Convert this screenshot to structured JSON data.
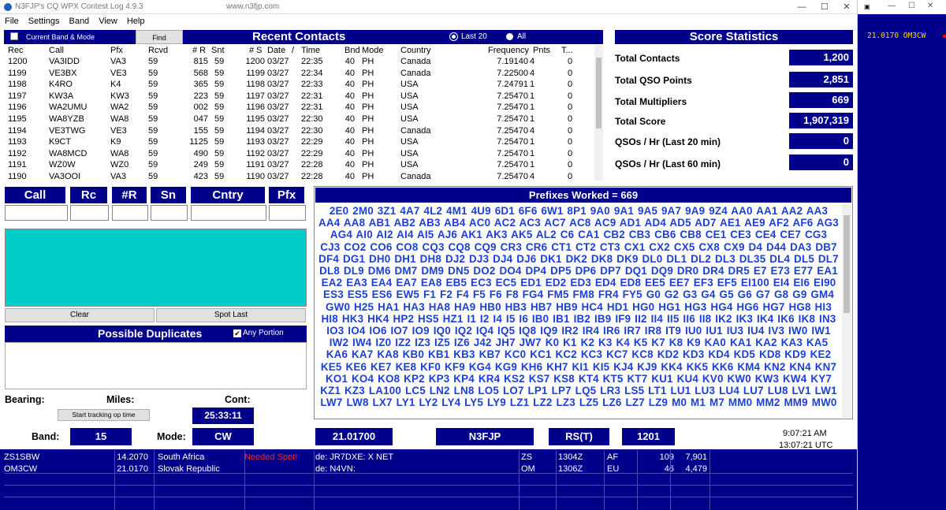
{
  "window": {
    "title": "N3FJP's CQ WPX Contest Log 4.9.3",
    "url": "www.n3fjp.com",
    "minimize": "—",
    "maximize": "☐",
    "close": "✕"
  },
  "menu": [
    "File",
    "Settings",
    "Band",
    "View",
    "Help"
  ],
  "recent": {
    "checkbox_label": "Current Band & Mode",
    "find_label": "Find",
    "title": "Recent Contacts",
    "radio_last20": "Last 20",
    "radio_all": "All",
    "columns": [
      "Rec",
      "Call",
      "Pfx",
      "Rcvd",
      "# R",
      "Snt",
      "# S",
      "Date",
      "/",
      "Time",
      "Bnd",
      "Mode",
      "Country",
      "Frequency",
      "Pnts",
      "T..."
    ],
    "rows": [
      [
        "1200",
        "VA3IDD",
        "VA3",
        "59",
        "815",
        "59",
        "1200",
        "03/27",
        "22:35",
        "40",
        "PH",
        "Canada",
        "7.19140",
        "4",
        "0"
      ],
      [
        "1199",
        "VE3BX",
        "VE3",
        "59",
        "568",
        "59",
        "1199",
        "03/27",
        "22:34",
        "40",
        "PH",
        "Canada",
        "7.22500",
        "4",
        "0"
      ],
      [
        "1198",
        "K4RO",
        "K4",
        "59",
        "365",
        "59",
        "1198",
        "03/27",
        "22:33",
        "40",
        "PH",
        "USA",
        "7.24791",
        "1",
        "0"
      ],
      [
        "1197",
        "KW3A",
        "KW3",
        "59",
        "223",
        "59",
        "1197",
        "03/27",
        "22:31",
        "40",
        "PH",
        "USA",
        "7.25470",
        "1",
        "0"
      ],
      [
        "1196",
        "WA2UMU",
        "WA2",
        "59",
        "002",
        "59",
        "1196",
        "03/27",
        "22:31",
        "40",
        "PH",
        "USA",
        "7.25470",
        "1",
        "0"
      ],
      [
        "1195",
        "WA8YZB",
        "WA8",
        "59",
        "047",
        "59",
        "1195",
        "03/27",
        "22:30",
        "40",
        "PH",
        "USA",
        "7.25470",
        "1",
        "0"
      ],
      [
        "1194",
        "VE3TWG",
        "VE3",
        "59",
        "155",
        "59",
        "1194",
        "03/27",
        "22:30",
        "40",
        "PH",
        "Canada",
        "7.25470",
        "4",
        "0"
      ],
      [
        "1193",
        "K9CT",
        "K9",
        "59",
        "1125",
        "59",
        "1193",
        "03/27",
        "22:29",
        "40",
        "PH",
        "USA",
        "7.25470",
        "1",
        "0"
      ],
      [
        "1192",
        "WA8MCD",
        "WA8",
        "59",
        "490",
        "59",
        "1192",
        "03/27",
        "22:29",
        "40",
        "PH",
        "USA",
        "7.25470",
        "1",
        "0"
      ],
      [
        "1191",
        "WZ0W",
        "WZ0",
        "59",
        "249",
        "59",
        "1191",
        "03/27",
        "22:28",
        "40",
        "PH",
        "USA",
        "7.25470",
        "1",
        "0"
      ],
      [
        "1190",
        "VA3OOI",
        "VA3",
        "59",
        "423",
        "59",
        "1190",
        "03/27",
        "22:28",
        "40",
        "PH",
        "Canada",
        "7.25470",
        "4",
        "0"
      ]
    ]
  },
  "stats": {
    "title": "Score Statistics",
    "items": [
      {
        "label": "Total Contacts",
        "value": "1,200"
      },
      {
        "label": "Total QSO Points",
        "value": "2,851"
      },
      {
        "label": "Total Multipliers",
        "value": "669"
      },
      {
        "label": "Total Score",
        "value": "1,907,319"
      },
      {
        "label": "QSOs / Hr (Last 20 min)",
        "value": "0"
      },
      {
        "label": "QSOs / Hr (Last 60 min)",
        "value": "0"
      }
    ]
  },
  "entry": {
    "call": "Call",
    "rc": "Rc",
    "nr": "#R",
    "sn": "Sn",
    "cntry": "Cntry",
    "pfx": "Pfx"
  },
  "buttons": {
    "clear": "Clear",
    "spot_last": "Spot Last",
    "track": "Start tracking op time"
  },
  "dupes": {
    "title": "Possible Duplicates",
    "any_portion": "Any Portion"
  },
  "info": {
    "bearing": "Bearing:",
    "miles": "Miles:",
    "cont": "Cont:",
    "timer": "25:33:11",
    "band_label": "Band:",
    "band": "15",
    "mode_label": "Mode:",
    "mode": "CW",
    "freq": "21.01700",
    "operator": "N3FJP",
    "rst": "RS(T)",
    "next": "1201",
    "local_time": "9:07:21  AM",
    "utc_time": "13:07:21  UTC"
  },
  "prefixes": {
    "title": "Prefixes Worked = 669",
    "text": "2E0 2M0 3Z1 4A7 4L2 4M1 4U9 6D1 6F6 6W1 8P1 9A0 9A1 9A5 9A7 9A9 9Z4 AA0 AA1 AA2 AA3 AA4 AA8 AB1 AB2 AB3 AB4 AC0 AC2 AC3 AC7 AC8 AC9 AD1 AD4 AD5 AD7 AE1 AE9 AF2 AF6 AG3 AG4 AI0 AI2 AI4 AI5 AJ6 AK1 AK3 AK5 AL2 C6 CA1 CB2 CB3 CB6 CB8 CE1 CE3 CE4 CE7 CG3 CJ3 CO2 CO6 CO8 CQ3 CQ8 CQ9 CR3 CR6 CT1 CT2 CT3 CX1 CX2 CX5 CX8 CX9 D4 D44 DA3 DB7 DF4 DG1 DH0 DH1 DH8 DJ2 DJ3 DJ4 DJ6 DK1 DK2 DK8 DK9 DL0 DL1 DL2 DL3 DL35 DL4 DL5 DL7 DL8 DL9 DM6 DM7 DM9 DN5 DO2 DO4 DP4 DP5 DP6 DP7 DQ1 DQ9 DR0 DR4 DR5 E7 E73 E77 EA1 EA2 EA3 EA4 EA7 EA8 EB5 EC3 EC5 ED1 ED2 ED3 ED4 ED8 EE5 EE7 EF3 EF5 EI100 EI4 EI6 EI90 ES3 ES5 ES6 EW5 F1 F2 F4 F5 F6 F8 FG4 FM5 FM8 FR4 FY5 G0 G2 G3 G4 G5 G6 G7 G8 G9 GM4 GW0 H25 HA1 HA3 HA8 HA9 HB0 HB3 HB7 HB9 HC4 HD1 HG0 HG1 HG3 HG4 HG6 HG7 HG8 HI3 HI8 HK3 HK4 HP2 HS5 HZ1 I1 I2 I4 I5 I6 IB0 IB1 IB2 IB9 IF9 II2 II4 II5 II6 II8 IK2 IK3 IK4 IK6 IK8 IN3 IO3 IO4 IO6 IO7 IO9 IQ0 IQ2 IQ4 IQ5 IQ8 IQ9 IR2 IR4 IR6 IR7 IR8 IT9 IU0 IU1 IU3 IU4 IV3 IW0 IW1 IW2 IW4 IZ0 IZ2 IZ3 IZ5 IZ6 J42 JH7 JW7 K0 K1 K2 K3 K4 K5 K7 K8 K9 KA0 KA1 KA2 KA3 KA5 KA6 KA7 KA8 KB0 KB1 KB3 KB7 KC0 KC1 KC2 KC3 KC7 KC8 KD2 KD3 KD4 KD5 KD8 KD9 KE2 KE5 KE6 KE7 KE8 KF0 KF9 KG4 KG9 KH6 KH7 KI1 KI5 KJ4 KJ9 KK4 KK5 KK6 KM4 KN2 KN4 KN7 KO1 KO4 KO8 KP2 KP3 KP4 KR4 KS2 KS7 KS8 KT4 KT5 KT7 KU1 KU4 KV0 KW0 KW3 KW4 KY7 KZ1 KZ3 LA100 LC5 LN2 LN8 LO5 LO7 LP1 LP7 LQ5 LR3 LS5 LT1 LU1 LU3 LU4 LU7 LU8 LV1 LW1 LW7 LW8 LX7 LY1 LY2 LY4 LY5 LY9 LZ1 LZ2 LZ3 LZ5 LZ6 LZ7 LZ9 M0 M1 M7 MM0 MM2 MM9 MW0"
  },
  "spots": [
    {
      "call": "ZS1SBW",
      "freq": "14.2070",
      "country": "South Africa",
      "flag": "Needed Spot!",
      "comment": "de: JR7DXE: X NET",
      "pfx": "ZS",
      "time": "1304Z",
      "cont": "AF",
      "bearing": "109",
      "miles": "7,901"
    },
    {
      "call": "OM3CW",
      "freq": "21.0170",
      "country": "Slovak Republic",
      "flag": "",
      "comment": "de: N4VN:",
      "pfx": "OM",
      "time": "1306Z",
      "cont": "EU",
      "bearing": "46",
      "miles": "4,479"
    }
  ],
  "side": {
    "freq_call": "21.0170  OM3CW"
  }
}
